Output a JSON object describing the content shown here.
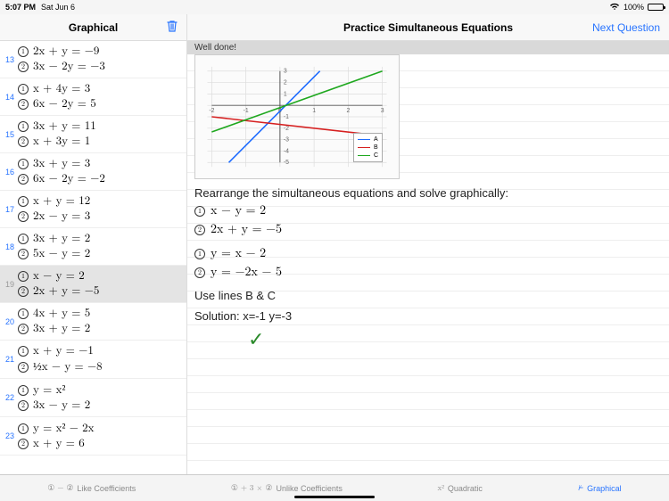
{
  "statusbar": {
    "time": "5:07 PM",
    "date": "Sat Jun 6",
    "battery_pct": "100%"
  },
  "sidebar": {
    "title": "Graphical",
    "trash_icon": "trash-icon",
    "items": [
      {
        "n": "13",
        "eq1": "2x + y = −9",
        "eq2": "3x − 2y = −3"
      },
      {
        "n": "14",
        "eq1": "x + 4y = 3",
        "eq2": "6x − 2y = 5"
      },
      {
        "n": "15",
        "eq1": "3x + y = 11",
        "eq2": "x + 3y = 1"
      },
      {
        "n": "16",
        "eq1": "3x + y = 3",
        "eq2": "6x − 2y = −2"
      },
      {
        "n": "17",
        "eq1": "x + y = 12",
        "eq2": "2x − y = 3"
      },
      {
        "n": "18",
        "eq1": "3x + y = 2",
        "eq2": "5x − y = 2"
      },
      {
        "n": "19",
        "eq1": "x − y = 2",
        "eq2": "2x + y = −5",
        "selected": true
      },
      {
        "n": "20",
        "eq1": "4x + y = 5",
        "eq2": "3x + y = 2"
      },
      {
        "n": "21",
        "eq1": "x + y = −1",
        "eq2": "½x − y = −8"
      },
      {
        "n": "22",
        "eq1": "y = x²",
        "eq2": "3x − y = 2"
      },
      {
        "n": "23",
        "eq1": "y = x² − 2x",
        "eq2": "x + y = 6"
      }
    ]
  },
  "content": {
    "title": "Practice Simultaneous Equations",
    "next_label": "Next Question",
    "banner": "Well done!",
    "instruction": "Rearrange the simultaneous equations and solve graphically:",
    "problem": {
      "eq1": "x − y = 2",
      "eq2": "2x + y = −5"
    },
    "rearranged": {
      "eq1": "y = x − 2",
      "eq2": "y = −2x − 5"
    },
    "hint_line": "Use lines B & C",
    "solution_line": "Solution:  x=-1  y=-3",
    "correct": true
  },
  "chart_data": {
    "type": "line",
    "xlim": [
      -2,
      3
    ],
    "ylim": [
      -5,
      3
    ],
    "grid": true,
    "x_ticks": [
      -2,
      -1,
      0,
      1,
      2,
      3
    ],
    "y_ticks": [
      -5,
      -4,
      -3,
      -2,
      -1,
      0,
      1,
      2,
      3
    ],
    "series": [
      {
        "name": "A",
        "color": "#1e6cff",
        "points": [
          [
            -1.5,
            -5
          ],
          [
            1.17,
            3
          ]
        ]
      },
      {
        "name": "B",
        "color": "#d62020",
        "points": [
          [
            -2,
            -1
          ],
          [
            3,
            -2.67
          ]
        ]
      },
      {
        "name": "C",
        "color": "#1fa81f",
        "points": [
          [
            -2,
            -2.33
          ],
          [
            3,
            3
          ]
        ]
      }
    ],
    "legend_position": "lower-right"
  },
  "tabs": [
    {
      "icon": "① − ②",
      "label": "Like Coefficients",
      "active": false
    },
    {
      "icon": "① + 3 × ②",
      "label": "Unlike Coefficients",
      "active": false
    },
    {
      "icon": "x²",
      "label": "Quadratic",
      "active": false
    },
    {
      "icon": "⊭",
      "label": "Graphical",
      "active": true
    }
  ]
}
